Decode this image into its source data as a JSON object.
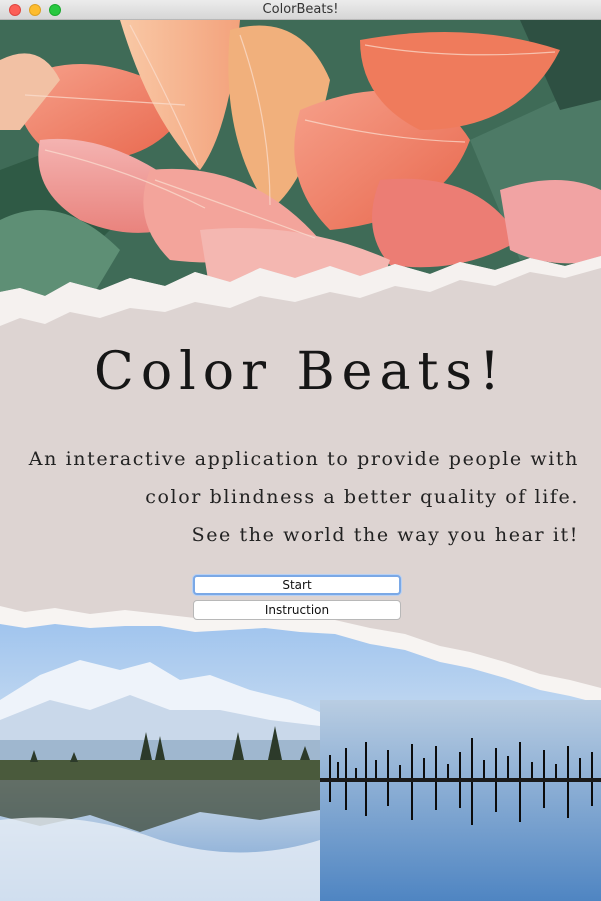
{
  "window": {
    "title": "ColorBeats!"
  },
  "main": {
    "heading": "Color Beats!",
    "description": [
      "An interactive application to provide people with",
      "color blindness a better quality of life.",
      "See the world the way you hear it!"
    ]
  },
  "buttons": {
    "start_label": "Start",
    "instruction_label": "Instruction"
  },
  "colors": {
    "paper": "#dcd4d2",
    "focus_ring": "#7aa8e6"
  }
}
